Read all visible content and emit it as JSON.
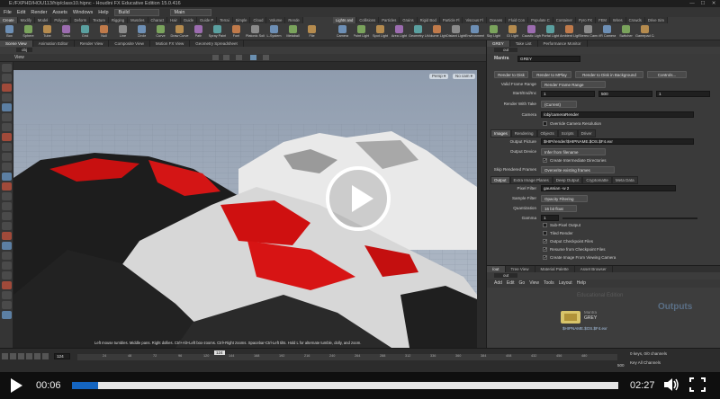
{
  "window": {
    "title": "E:/FXPHD/HOU113/hip/class10.hipnc - Houdini FX Educative Edition 15.0.416",
    "min": "—",
    "max": "☐",
    "close": "✕"
  },
  "menubar": {
    "items": [
      "File",
      "Edit",
      "Render",
      "Assets",
      "Windows",
      "Help"
    ],
    "desktop": "Build",
    "context": "Main"
  },
  "shelf_left": {
    "tabs": [
      "Create",
      "Modify",
      "Model",
      "Polygon",
      "Deform",
      "Texture",
      "Rigging",
      "Muscles",
      "Charact",
      "Hair",
      "Guide",
      "Guide P",
      "Terrai",
      "Simple",
      "Cloud",
      "Volume",
      "Rende"
    ],
    "tools": [
      "Box",
      "Sphere",
      "Tube",
      "Torus",
      "Grid",
      "Null",
      "Line",
      "Circle",
      "Curve",
      "Draw Curve",
      "Path",
      "Spray Paint",
      "Font",
      "Platonic Solids",
      "L-System",
      "Metaball",
      "File"
    ]
  },
  "shelf_right": {
    "tabs": [
      "Lights and",
      "Collisions",
      "Particles",
      "Grains",
      "Rigid Bod",
      "Particle Fl",
      "Viscous Fl",
      "Oceans",
      "Fluid Con",
      "Populate C",
      "Container",
      "Pyro FX",
      "FEM",
      "Wires",
      "Crowds",
      "Drive Sim"
    ],
    "tools": [
      "Camera",
      "Point Light",
      "Spot Light",
      "Area Light",
      "Geometry Light",
      "Volume Light",
      "Distant Light",
      "Environment Light",
      "Sky Light",
      "GI Light",
      "Caustic Light",
      "Portal Light",
      "Ambient Light",
      "Stereo Camera",
      "VR Camera",
      "Switcher",
      "Gamepad Camera"
    ]
  },
  "left_pane": {
    "tabs": [
      "Scene View",
      "Animation Editor",
      "Render View",
      "Composite View",
      "Motion FX View",
      "Geometry Spreadsheet"
    ],
    "view_label": "View",
    "path": "obj",
    "persp": "Persp ▾",
    "cam": "No cam ▾",
    "status": "Left mouse tumbles. Middle pans. Right dollies. Ctrl+Alt+Left box-zooms. Ctrl+Right zooms. Spacebar-Ctrl-Left tilts. Hold L for alternate tumble, dolly, and zoom."
  },
  "right_top": {
    "tabs": [
      "GREY",
      "Take List",
      "Performance Monitor"
    ],
    "path": "out",
    "node_type": "Mantra",
    "node_name": "GREY",
    "buttons": [
      "Render to Disk",
      "Render to MPlay",
      "Render to Disk in Background",
      "Controls..."
    ],
    "valid_frame_range_label": "Valid Frame Range",
    "valid_frame_range": "Render Frame Range",
    "start_end_label": "Start/End/Inc",
    "start": "1",
    "end": "500",
    "inc": "1",
    "render_take_label": "Render With Take",
    "render_take": "(Current)",
    "camera_label": "Camera",
    "camera": "/obj/cameraRender",
    "override_res": "Override Camera Resolution",
    "tabs2": [
      "Images",
      "Rendering",
      "Objects",
      "Scripts",
      "Driver"
    ],
    "output_picture_label": "Output Picture",
    "output_picture": "$HIP/render/$HIPNAME.$OS.$F4.exr",
    "output_device_label": "Output Device",
    "output_device": "Infer from filename",
    "create_dirs": "Create Intermediate Directories",
    "skip_frames_label": "Skip Rendered Frames",
    "skip_frames": "Overwrite existing frames",
    "tabs3": [
      "Output",
      "Extra Image Planes",
      "Deep Output",
      "Cryptomatte",
      "Meta Data"
    ],
    "pixel_filter_label": "Pixel Filter",
    "pixel_filter": "gaussian -w 2",
    "sample_filter_label": "Sample Filter",
    "sample_filter": "Opacity Filtering",
    "quantization_label": "Quantization",
    "quantization": "16 bit float",
    "gamma_label": "Gamma",
    "gamma": "1",
    "checks": [
      "Sub-Pixel Output",
      "Tiled Render",
      "Output Checkpoint Files",
      "Resume from Checkpoint Files",
      "Create Image From Viewing Camera"
    ]
  },
  "right_bottom": {
    "tabs": [
      "/out",
      "Tree View",
      "Material Palette",
      "Asset Browser"
    ],
    "path": "out",
    "menu": [
      "Add",
      "Edit",
      "Go",
      "View",
      "Tools",
      "Layout",
      "Help"
    ],
    "watermark": "Outputs",
    "node_type": "Mantra",
    "node_name": "GREY",
    "node_output": "$HIPNAME.$OS.$F4.exr",
    "edition": "Educational Edition"
  },
  "timeline": {
    "frame": "124",
    "marker": "124",
    "ticks": [
      "24",
      "48",
      "72",
      "96",
      "120",
      "144",
      "168",
      "192",
      "216",
      "240",
      "264",
      "288",
      "312",
      "336",
      "360",
      "384",
      "408",
      "432",
      "456",
      "480"
    ],
    "keys_info": "0 keys, 0/0 channels",
    "channels": "Key All Channels",
    "end_frame": "500"
  },
  "player": {
    "current_time": "00:06",
    "total_time": "02:27",
    "progress": 0.048
  }
}
